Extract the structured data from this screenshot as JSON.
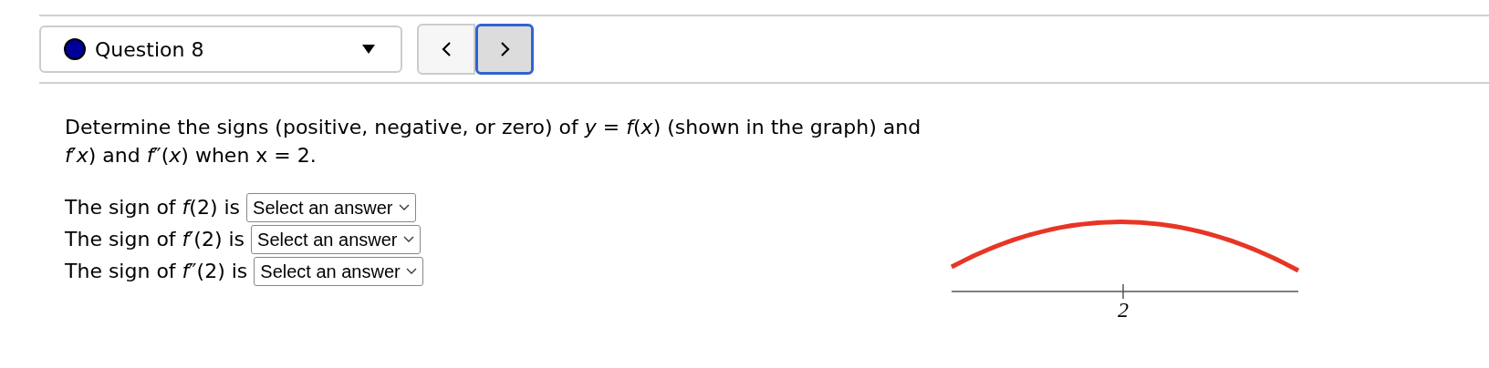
{
  "question_selector": {
    "label": "Question 8"
  },
  "nav_buttons": [
    {
      "kind": "previous",
      "focused": false
    },
    {
      "kind": "next",
      "focused": true
    }
  ],
  "prompt": "Determine the signs (positive, negative, or zero) of *y* = *f*(*x*) (shown in the graph) and *f*′*x*) and *f*″(*x*) when x = 2.",
  "answers": [
    {
      "label": "The sign of *f*(2) is",
      "value": "Select an answer"
    },
    {
      "label": "The sign of *f*′(2) is",
      "value": "Select an answer"
    },
    {
      "label": "The sign of *f*″(2) is",
      "value": "Select an answer"
    }
  ],
  "graph": {
    "tick_label": "2"
  }
}
